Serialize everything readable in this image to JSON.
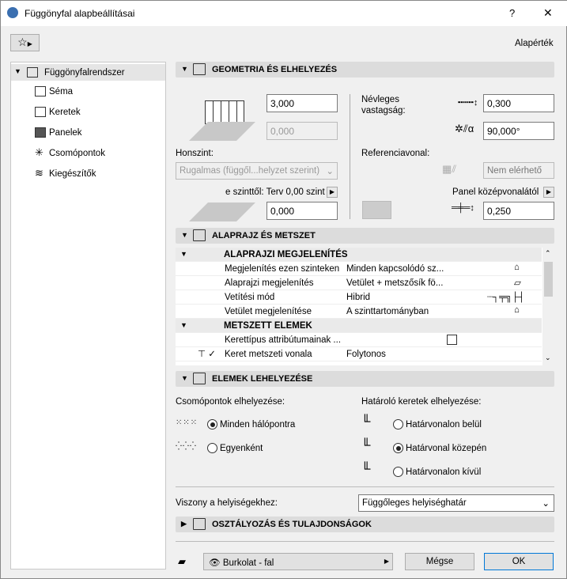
{
  "window": {
    "title": "Függönyfal alapbeállításai",
    "help": "?",
    "close": "✕"
  },
  "toolbar": {
    "default_label": "Alapérték"
  },
  "sidebar": {
    "items": [
      {
        "label": "Függönyfalrendszer"
      },
      {
        "label": "Séma"
      },
      {
        "label": "Keretek"
      },
      {
        "label": "Panelek"
      },
      {
        "label": "Csomópontok"
      },
      {
        "label": "Kiegészítők"
      }
    ]
  },
  "geometry": {
    "title": "GEOMETRIA ÉS ELHELYEZÉS",
    "height": "3,000",
    "offset": "0,000",
    "top_link_label": "Honszint:",
    "top_link_value": "Rugalmas (függől...helyzet szerint)",
    "base_label": "e szinttől: Terv 0,00 szint",
    "base_offset": "0,000",
    "nominal_label_1": "Névleges",
    "nominal_label_2": "vastagság:",
    "thickness": "0,300",
    "angle": "90,000°",
    "ref_label": "Referenciavonal:",
    "ref_value": "Nem elérhető",
    "panel_label": "Panel középvonalától",
    "panel_offset": "0,250"
  },
  "floorplan": {
    "title": "ALAPRAJZ ÉS METSZET",
    "rows": [
      {
        "type": "group",
        "a": "ALAPRAJZI MEGJELENÍTÉS"
      },
      {
        "a": "Megjelenítés ezen szinteken",
        "b": "Minden kapcsolódó sz..."
      },
      {
        "a": "Alaprajzi megjelenítés",
        "b": "Vetület + metszősík fö..."
      },
      {
        "a": "Vetítési mód",
        "b": "Hibrid"
      },
      {
        "a": "Vetület megjelenítése",
        "b": "A szinttartományban"
      },
      {
        "type": "group",
        "a": "METSZETT ELEMEK"
      },
      {
        "a": "Kerettípus attribútumainak ...",
        "b": ""
      },
      {
        "a": "Keret metszeti vonala",
        "b": "Folytonos"
      }
    ]
  },
  "placement": {
    "title": "ELEMEK LEHELYEZÉSE",
    "nodes_label": "Csomópontok elhelyezése:",
    "nodes_opts": [
      "Minden hálópontra",
      "Egyenként"
    ],
    "nodes_selected": 0,
    "frames_label": "Határoló keretek elhelyezése:",
    "frames_opts": [
      "Határvonalon belül",
      "Határvonal közepén",
      "Határvonalon kívül"
    ],
    "frames_selected": 1,
    "relation_label": "Viszony a helyiségekhez:",
    "relation_value": "Függőleges helyiséghatár"
  },
  "classification": {
    "title": "OSZTÁLYOZÁS ÉS TULAJDONSÁGOK"
  },
  "footer": {
    "layer": "Burkolat - fal",
    "cancel": "Mégse",
    "ok": "OK"
  }
}
